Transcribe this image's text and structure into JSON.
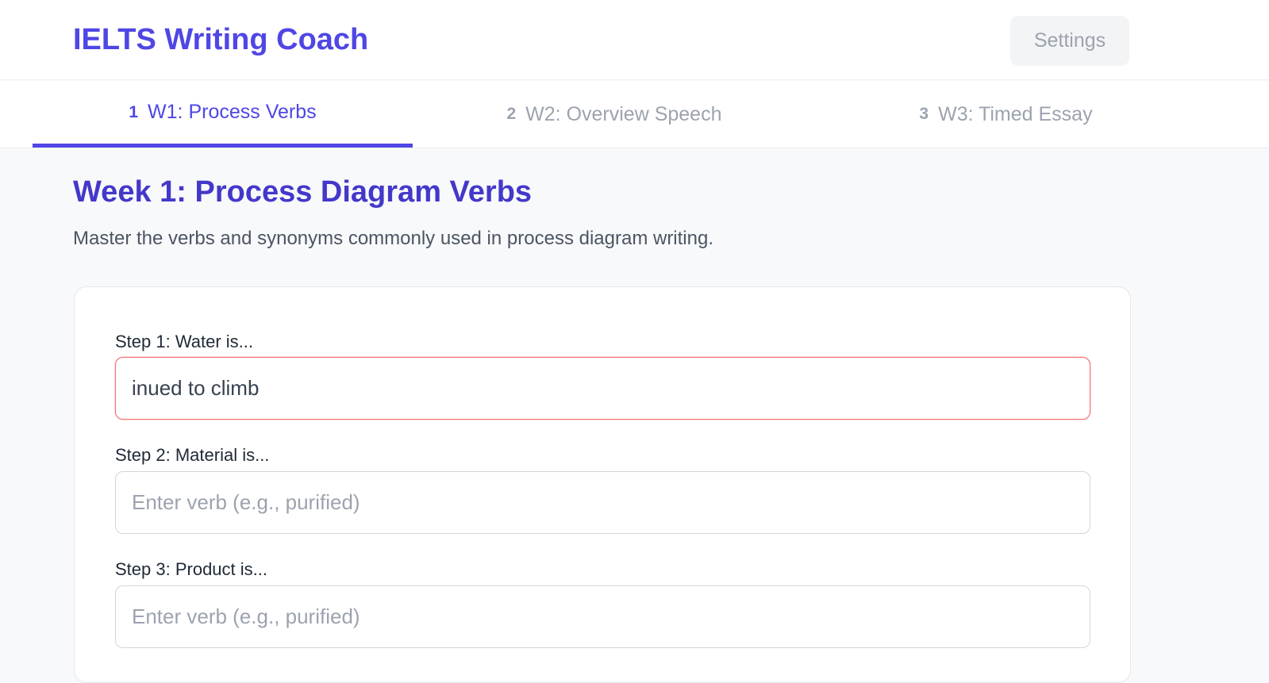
{
  "app": {
    "title": "IELTS Writing Coach",
    "settings_label": "Settings"
  },
  "tabs": [
    {
      "num": "1",
      "label": "W1: Process Verbs",
      "active": true
    },
    {
      "num": "2",
      "label": "W2: Overview Speech",
      "active": false
    },
    {
      "num": "3",
      "label": "W3: Timed Essay",
      "active": false
    }
  ],
  "section": {
    "title": "Week 1: Process Diagram Verbs",
    "description": "Master the verbs and synonyms commonly used in process diagram writing."
  },
  "steps": [
    {
      "label": "Step 1: Water is...",
      "value": "inued to climb",
      "placeholder": "Enter verb (e.g., purified)",
      "state": "error"
    },
    {
      "label": "Step 2: Material is...",
      "value": "",
      "placeholder": "Enter verb (e.g., purified)",
      "state": "normal"
    },
    {
      "label": "Step 3: Product is...",
      "value": "",
      "placeholder": "Enter verb (e.g., purified)",
      "state": "normal"
    }
  ],
  "colors": {
    "accent": "#4f46e5",
    "error_border": "#f87171",
    "muted_text": "#9ca3af"
  }
}
